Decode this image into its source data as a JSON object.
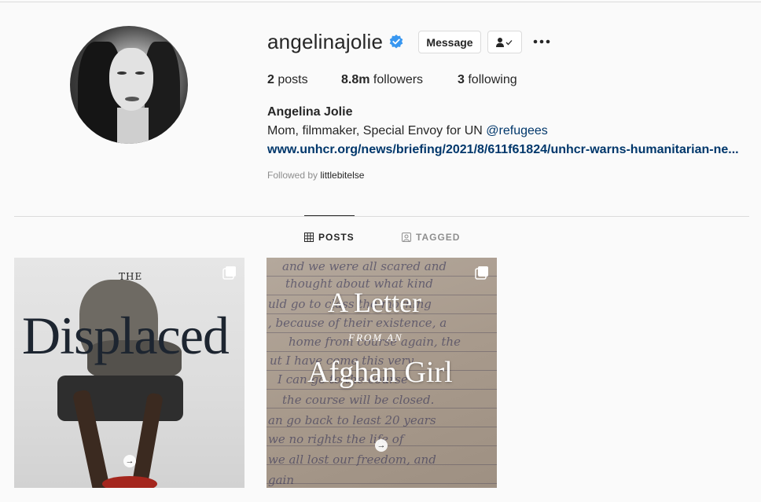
{
  "profile": {
    "username": "angelinajolie",
    "message_label": "Message",
    "stats": {
      "posts_count": "2",
      "posts_label": "posts",
      "followers_count": "8.8m",
      "followers_label": "followers",
      "following_count": "3",
      "following_label": "following"
    },
    "full_name": "Angelina Jolie",
    "bio_text": "Mom, filmmaker, Special Envoy for UN ",
    "bio_mention": "@refugees",
    "bio_link": "www.unhcr.org/news/briefing/2021/8/611f61824/unhcr-warns-humanitarian-ne...",
    "followed_by_prefix": "Followed by ",
    "followed_by_user": "littlebitelse"
  },
  "tabs": [
    {
      "label": "POSTS",
      "active": true
    },
    {
      "label": "TAGGED",
      "active": false
    }
  ],
  "posts": [
    {
      "the": "THE",
      "title": "Displaced"
    },
    {
      "title_line1": "A Letter",
      "from_line": "FROM AN",
      "title_line2": "Afghan Girl",
      "handwriting": [
        "and we were all scared and",
        "thought about what kind",
        "uld go to class the morning",
        ", because of their existence, a",
        "home from course again, the",
        "ut I have come this very",
        "I can go to the course",
        "the course will be closed.",
        "an go back to least 20 years",
        "we no rights the life of",
        "we all lost our freedom, and",
        "gain"
      ]
    }
  ],
  "colors": {
    "accent_link": "#00376b",
    "verified_blue": "#3897f0",
    "text": "#262626",
    "muted": "#8e8e8e"
  }
}
